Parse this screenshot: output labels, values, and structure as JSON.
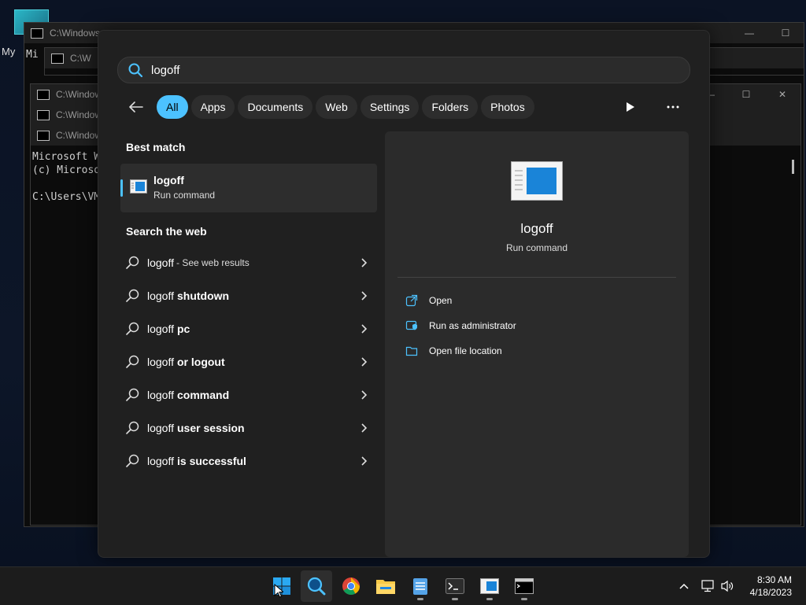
{
  "desktop": {
    "icon_label": "My",
    "cmd_title": "C:\\Windows",
    "cmd_title_short": "C:\\W",
    "cmd_lines": [
      "Microsoft W",
      "(c) Microso",
      "",
      "C:\\Users\\VM"
    ],
    "cmd_fragment": "Mi"
  },
  "search": {
    "query": "logoff",
    "filters": [
      "All",
      "Apps",
      "Documents",
      "Web",
      "Settings",
      "Folders",
      "Photos"
    ],
    "best_match_title": "Best match",
    "best_match": {
      "name": "logoff",
      "type": "Run command"
    },
    "web_title": "Search the web",
    "web_results": [
      {
        "base": "logoff",
        "bold": "",
        "extra": "- See web results"
      },
      {
        "base": "logoff",
        "bold": "shutdown",
        "extra": ""
      },
      {
        "base": "logoff",
        "bold": "pc",
        "extra": ""
      },
      {
        "base": "logoff",
        "bold": "or logout",
        "extra": ""
      },
      {
        "base": "logoff",
        "bold": "command",
        "extra": ""
      },
      {
        "base": "logoff",
        "bold": "user session",
        "extra": ""
      },
      {
        "base": "logoff",
        "bold": "is successful",
        "extra": ""
      }
    ],
    "preview": {
      "name": "logoff",
      "type": "Run command",
      "actions": [
        "Open",
        "Run as administrator",
        "Open file location"
      ]
    }
  },
  "taskbar": {
    "time": "8:30 AM",
    "date": "4/18/2023"
  },
  "colors": {
    "accent": "#4cc2ff",
    "panel": "#202020",
    "taskbar": "#1c1c1c"
  }
}
